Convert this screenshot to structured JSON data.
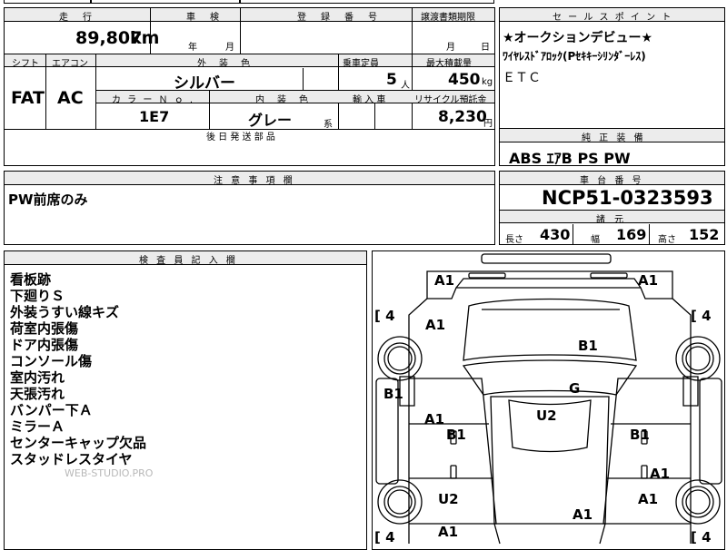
{
  "vehicle": {
    "headers": {
      "mileage": "走　行",
      "inspection": "車　検",
      "registration": "登　録　番　号",
      "transfer": "譲渡書類期限",
      "shift": "シフト",
      "aircon": "エアコン",
      "exterior_color": "外　装　色",
      "capacity": "乗車定員",
      "max_load": "最大積載量",
      "color_no": "カ ラ ー Ｎ ｏ .",
      "interior_color": "内　装　色",
      "import": "輸 入 車",
      "recycle": "リサイクル預託金",
      "later_parts": "後 日 発 送 部 品"
    },
    "mileage": "89,807",
    "mileage_unit": "km",
    "inspection_month": "月",
    "inspection_year": "年",
    "transfer_month": "月",
    "transfer_day": "日",
    "shift": "FAT",
    "aircon": "AC",
    "exterior_color": "シルバー",
    "capacity": "5",
    "capacity_unit": "人",
    "max_load": "450",
    "max_load_unit": "kg",
    "color_no": "1E7",
    "interior_color": "グレー",
    "interior_suffix": "系",
    "recycle_amount": "8,230",
    "recycle_unit": "円"
  },
  "sales_points": {
    "header": "セ ー ル ス ポ イ ン ト",
    "lines": [
      "★オークションデビュー★",
      "ﾜｲﾔﾚｽﾄﾞｱﾛｯｸ(Pｾｷｷｰｼﾘﾝﾀﾞｰﾚｽ)",
      "ＥＴＣ"
    ]
  },
  "genuine_equipment": {
    "header": "純 正 装 備",
    "value": "ABS ｴｱB PS PW"
  },
  "notes": {
    "header": "注 意 事 項 欄",
    "value": "PW前席のみ"
  },
  "chassis": {
    "header": "車 台 番 号",
    "value": "NCP51-0323593",
    "specs_header": "諸　元",
    "length_label": "長さ",
    "length": "430",
    "width_label": "幅",
    "width": "169",
    "height_label": "高さ",
    "height": "152"
  },
  "inspector": {
    "header": "検 査 員 記 入 欄",
    "items": [
      "看板跡",
      "下廻りＳ",
      "外装うすい線キズ",
      "荷室内張傷",
      "ドア内張傷",
      "コンソール傷",
      "室内汚れ",
      "天張汚れ",
      "バンパー下Ａ",
      "ミラーＡ",
      "センターキャップ欠品",
      "スタッドレスタイヤ"
    ],
    "watermark": "WEB-STUDIO.PRO"
  },
  "diagram": {
    "tire_top_left": "4",
    "tire_top_right": "4",
    "tire_bot_left": "4",
    "tire_bot_right": "4",
    "labels": [
      "A1",
      "A1",
      "A1",
      "B1",
      "B1",
      "G",
      "U2",
      "A1",
      "B1",
      "B1",
      "A1",
      "U2",
      "A1",
      "A1",
      "A1"
    ]
  }
}
